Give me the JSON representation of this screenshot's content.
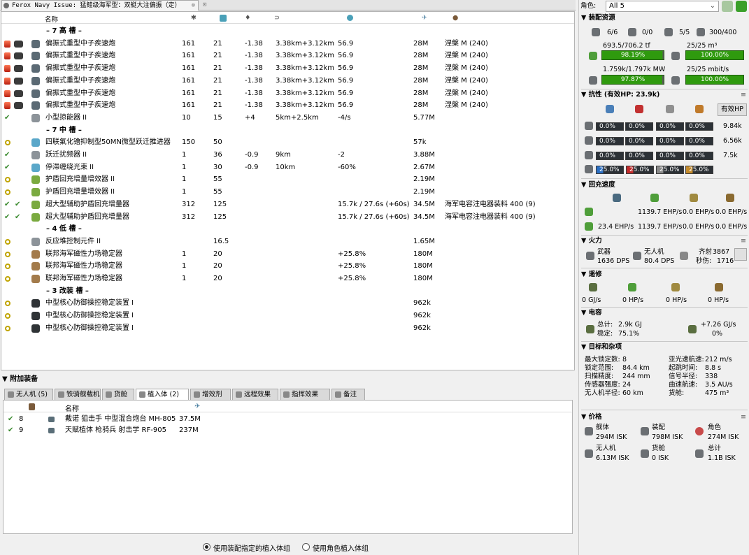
{
  "fit_tabs": [
    {
      "label": "Ferox Navy Issue: 猛鲑级海军型：双艇大注偏振（定）"
    }
  ],
  "module_table": {
    "headers": [
      "名称"
    ],
    "rows": [
      {
        "kind": "sep",
        "name": "– 7 高 槽 –"
      },
      {
        "kind": "mod",
        "state": "overload",
        "name": "偏振式重型中子疾速炮",
        "c1": "161",
        "c2": "21",
        "c3": "-1.38",
        "c4": "3.38km+3.12km",
        "c5": "56.9",
        "c6": "",
        "c7": "28M",
        "c8": "涅槃 M (240)",
        "icon": "gun"
      },
      {
        "kind": "mod",
        "state": "overload",
        "name": "偏振式重型中子疾速炮",
        "c1": "161",
        "c2": "21",
        "c3": "-1.38",
        "c4": "3.38km+3.12km",
        "c5": "56.9",
        "c6": "",
        "c7": "28M",
        "c8": "涅槃 M (240)",
        "icon": "gun"
      },
      {
        "kind": "mod",
        "state": "overload",
        "name": "偏振式重型中子疾速炮",
        "c1": "161",
        "c2": "21",
        "c3": "-1.38",
        "c4": "3.38km+3.12km",
        "c5": "56.9",
        "c6": "",
        "c7": "28M",
        "c8": "涅槃 M (240)",
        "icon": "gun"
      },
      {
        "kind": "mod",
        "state": "overload",
        "name": "偏振式重型中子疾速炮",
        "c1": "161",
        "c2": "21",
        "c3": "-1.38",
        "c4": "3.38km+3.12km",
        "c5": "56.9",
        "c6": "",
        "c7": "28M",
        "c8": "涅槃 M (240)",
        "icon": "gun"
      },
      {
        "kind": "mod",
        "state": "overload",
        "name": "偏振式重型中子疾速炮",
        "c1": "161",
        "c2": "21",
        "c3": "-1.38",
        "c4": "3.38km+3.12km",
        "c5": "56.9",
        "c6": "",
        "c7": "28M",
        "c8": "涅槃 M (240)",
        "icon": "gun"
      },
      {
        "kind": "mod",
        "state": "overload",
        "name": "偏振式重型中子疾速炮",
        "c1": "161",
        "c2": "21",
        "c3": "-1.38",
        "c4": "3.38km+3.12km",
        "c5": "56.9",
        "c6": "",
        "c7": "28M",
        "c8": "涅槃 M (240)",
        "icon": "gun"
      },
      {
        "kind": "mod",
        "state": "active",
        "name": "小型掠能器 II",
        "c1": "10",
        "c2": "15",
        "c3": "+4",
        "c4": "5km+2.5km",
        "c5": "-4/s",
        "c6": "",
        "c7": "5.77M",
        "c8": "",
        "icon": "grey"
      },
      {
        "kind": "sep",
        "name": "– 7 中 槽 –"
      },
      {
        "kind": "mod",
        "state": "online",
        "name": "四联氟化镥抑制型50MN微型跃迁推进器",
        "c1": "150",
        "c2": "50",
        "c3": "",
        "c4": "",
        "c5": "",
        "c6": "",
        "c7": "57k",
        "c8": "",
        "icon": "blue"
      },
      {
        "kind": "mod",
        "state": "active",
        "name": "跃迁扰频器 II",
        "c1": "1",
        "c2": "36",
        "c3": "-0.9",
        "c4": "9km",
        "c5": "-2",
        "c6": "",
        "c7": "3.88M",
        "c8": "",
        "icon": "grey"
      },
      {
        "kind": "mod",
        "state": "active",
        "name": "停滞缠绕光束 II",
        "c1": "1",
        "c2": "30",
        "c3": "-0.9",
        "c4": "10km",
        "c5": "-60%",
        "c6": "",
        "c7": "2.67M",
        "c8": "",
        "icon": "blue"
      },
      {
        "kind": "mod",
        "state": "online",
        "name": "护盾回充增量增效器 II",
        "c1": "1",
        "c2": "55",
        "c3": "",
        "c4": "",
        "c5": "",
        "c6": "",
        "c7": "2.19M",
        "c8": "",
        "icon": "green"
      },
      {
        "kind": "mod",
        "state": "online",
        "name": "护盾回充增量增效器 II",
        "c1": "1",
        "c2": "55",
        "c3": "",
        "c4": "",
        "c5": "",
        "c6": "",
        "c7": "2.19M",
        "c8": "",
        "icon": "green"
      },
      {
        "kind": "mod",
        "state": "active",
        "name": "超大型辅助护盾回充增量器",
        "c1": "312",
        "c2": "125",
        "c3": "",
        "c4": "",
        "c5": "15.7k / 27.6s (+60s)",
        "c6": "",
        "c7": "34.5M",
        "c8": "海军电容注电器装料 400 (9)",
        "icon": "green",
        "charge": true
      },
      {
        "kind": "mod",
        "state": "active",
        "name": "超大型辅助护盾回充增量器",
        "c1": "312",
        "c2": "125",
        "c3": "",
        "c4": "",
        "c5": "15.7k / 27.6s (+60s)",
        "c6": "",
        "c7": "34.5M",
        "c8": "海军电容注电器装料 400 (9)",
        "icon": "green",
        "charge": true
      },
      {
        "kind": "sep",
        "name": "– 4 低 槽 –"
      },
      {
        "kind": "mod",
        "state": "online",
        "name": "反应堆控制元件 II",
        "c1": "",
        "c2": "16.5",
        "c3": "",
        "c4": "",
        "c5": "",
        "c6": "",
        "c7": "1.65M",
        "c8": "",
        "icon": "grey"
      },
      {
        "kind": "mod",
        "state": "online",
        "name": "联邦海军磁性力场稳定器",
        "c1": "1",
        "c2": "20",
        "c3": "",
        "c4": "",
        "c5": "+25.8%",
        "c6": "",
        "c7": "180M",
        "c8": "",
        "icon": "brown"
      },
      {
        "kind": "mod",
        "state": "online",
        "name": "联邦海军磁性力场稳定器",
        "c1": "1",
        "c2": "20",
        "c3": "",
        "c4": "",
        "c5": "+25.8%",
        "c6": "",
        "c7": "180M",
        "c8": "",
        "icon": "brown"
      },
      {
        "kind": "mod",
        "state": "online",
        "name": "联邦海军磁性力场稳定器",
        "c1": "1",
        "c2": "20",
        "c3": "",
        "c4": "",
        "c5": "+25.8%",
        "c6": "",
        "c7": "180M",
        "c8": "",
        "icon": "brown"
      },
      {
        "kind": "sep",
        "name": "– 3 改装 槽 –"
      },
      {
        "kind": "mod",
        "state": "online",
        "name": "中型核心防御操控稳定装置 I",
        "c1": "",
        "c2": "",
        "c3": "",
        "c4": "",
        "c5": "",
        "c6": "",
        "c7": "962k",
        "c8": "",
        "icon": "dark"
      },
      {
        "kind": "mod",
        "state": "online",
        "name": "中型核心防御操控稳定装置 I",
        "c1": "",
        "c2": "",
        "c3": "",
        "c4": "",
        "c5": "",
        "c6": "",
        "c7": "962k",
        "c8": "",
        "icon": "dark"
      },
      {
        "kind": "mod",
        "state": "online",
        "name": "中型核心防御操控稳定装置 I",
        "c1": "",
        "c2": "",
        "c3": "",
        "c4": "",
        "c5": "",
        "c6": "",
        "c7": "962k",
        "c8": "",
        "icon": "dark"
      }
    ]
  },
  "dock": {
    "title": "▼ 附加装备",
    "tabs": [
      {
        "label": "无人机 (5)",
        "active": false
      },
      {
        "label": "铁骑舰载机",
        "active": false
      },
      {
        "label": "货舱",
        "active": false
      },
      {
        "label": "植入体 (2)",
        "active": true
      },
      {
        "label": "增效剂",
        "active": false
      },
      {
        "label": "远程效果",
        "active": false
      },
      {
        "label": "指挥效果",
        "active": false
      },
      {
        "label": "备注",
        "active": false
      }
    ],
    "implant_header": "名称",
    "implants": [
      {
        "slot": "8",
        "name": "戴诺 狙击手 中型混合炮台 MH-805",
        "price": "37.5M"
      },
      {
        "slot": "9",
        "name": "天赋植体 枪骑兵 射击学 RF-905",
        "price": "237M"
      }
    ],
    "radio_fit": "使用装配指定的植入体组",
    "radio_char": "使用角色植入体组"
  },
  "right": {
    "char_label": "角色:",
    "char_value": "All 5",
    "resources": {
      "title": "▼ 装配资源",
      "hardpoints": [
        "6/6",
        "0/0",
        "5/5",
        "300/400"
      ],
      "cpu_text": "693.5/706.2 tf",
      "cpu_pct": "98.19%",
      "cpu_frac": 0.9819,
      "cal_text": "25/25 m³",
      "cal_pct": "100.00%",
      "cal_frac": 1.0,
      "pg_text": "1.759k/1.797k MW",
      "pg_pct": "97.87%",
      "pg_frac": 0.9787,
      "bw_text": "25/25 mbit/s",
      "bw_pct": "100.00%",
      "bw_frac": 1.0
    },
    "resist": {
      "title": "▼ 抗性 (有效HP: 23.9k)",
      "ehp_btn": "有效HP",
      "rows": [
        {
          "vals": [
            "0.0%",
            "0.0%",
            "0.0%",
            "0.0%"
          ],
          "hp": "9.84k"
        },
        {
          "vals": [
            "0.0%",
            "0.0%",
            "0.0%",
            "0.0%"
          ],
          "hp": "6.56k"
        },
        {
          "vals": [
            "0.0%",
            "0.0%",
            "0.0%",
            "0.0%"
          ],
          "hp": "7.5k"
        }
      ],
      "profile": [
        "25.0%",
        "25.0%",
        "25.0%",
        "25.0%"
      ],
      "colors": [
        "#2a6fc4",
        "#c42a2a",
        "#8a8a8a",
        "#c48a2a"
      ]
    },
    "recharge": {
      "title": "▼ 回充速度",
      "row1": [
        "1139.7 EHP/s",
        "0.0 EHP/s",
        "0.0 EHP/s"
      ],
      "row2": [
        "23.4 EHP/s",
        "1139.7 EHP/s",
        "0.0 EHP/s",
        "0.0 EHP/s"
      ]
    },
    "firepower": {
      "title": "▼ 火力",
      "weapon_label": "武器",
      "weapon_dps": "1636 DPS",
      "drone_label": "无人机",
      "drone_dps": "80.4 DPS",
      "volley_label": "齐射",
      "volley": "3867",
      "sec_label": "秒伤:",
      "sec_dps": "1716"
    },
    "remote": {
      "title": "▼ 遥修",
      "vals": [
        "0 GJ/s",
        "0 HP/s",
        "0 HP/s",
        "0 HP/s"
      ]
    },
    "cap": {
      "title": "▼ 电容",
      "total_label": "总计:",
      "total": "2.9k GJ",
      "stable_label": "稳定:",
      "stable": "75.1%",
      "delta": "+7.26 GJ/s",
      "delta_pct": "0%"
    },
    "targeting": {
      "title": "▼ 目标和杂项",
      "left": [
        {
          "k": "最大锁定数:",
          "v": "8"
        },
        {
          "k": "锁定范围:",
          "v": "84.4 km"
        },
        {
          "k": "扫描精度:",
          "v": "244 mm"
        },
        {
          "k": "传感器强度:",
          "v": "24"
        },
        {
          "k": "无人机半径:",
          "v": "60 km"
        }
      ],
      "right": [
        {
          "k": "亚光速航速:",
          "v": "212 m/s"
        },
        {
          "k": "起跳时间:",
          "v": "8.8 s"
        },
        {
          "k": "信号半径:",
          "v": "338"
        },
        {
          "k": "曲速航速:",
          "v": "3.5 AU/s"
        },
        {
          "k": "货舱:",
          "v": "475 m³"
        }
      ]
    },
    "price": {
      "title": "▼ 价格",
      "items": [
        {
          "k": "舰体",
          "v": "294M ISK"
        },
        {
          "k": "装配",
          "v": "798M ISK"
        },
        {
          "k": "角色",
          "v": "274M ISK"
        },
        {
          "k": "无人机",
          "v": "6.13M ISK"
        },
        {
          "k": "货舱",
          "v": "0 ISK"
        },
        {
          "k": "总计",
          "v": "1.1B ISK"
        }
      ]
    }
  }
}
